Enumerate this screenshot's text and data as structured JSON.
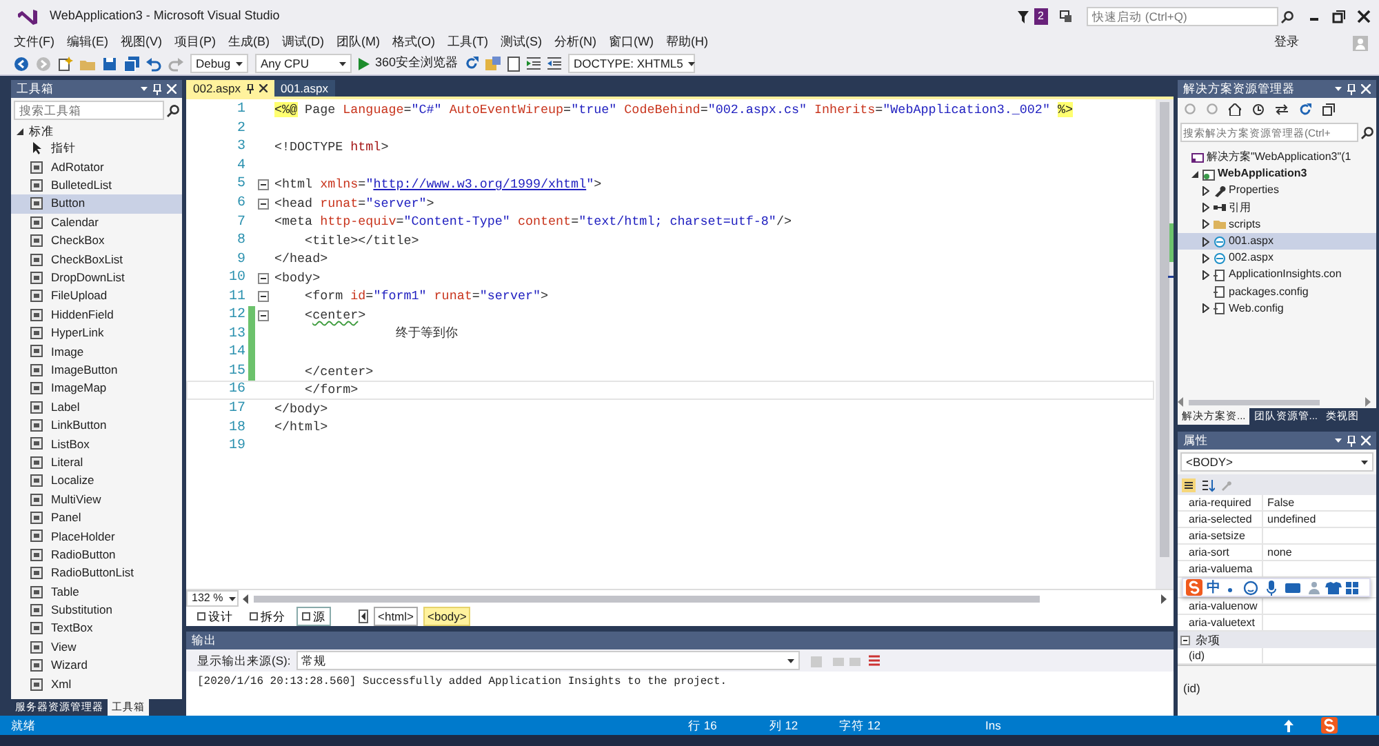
{
  "window": {
    "title": "WebApplication3 - Microsoft Visual Studio",
    "notification_count": "2",
    "quick_launch": {
      "placeholder": "快速启动 (Ctrl+Q)"
    },
    "sign_in": "登录"
  },
  "menu": [
    "文件(F)",
    "编辑(E)",
    "视图(V)",
    "项目(P)",
    "生成(B)",
    "调试(D)",
    "团队(M)",
    "格式(O)",
    "工具(T)",
    "测试(S)",
    "分析(N)",
    "窗口(W)",
    "帮助(H)"
  ],
  "toolbar": {
    "configuration": "Debug",
    "platform": "Any CPU",
    "run_target": "360安全浏览器",
    "doctype": "DOCTYPE: XHTML5"
  },
  "toolbox": {
    "title": "工具箱",
    "search": {
      "placeholder": "搜索工具箱"
    },
    "group": "标准",
    "items": [
      {
        "label": "指针",
        "kind": "pointer",
        "selected": false
      },
      {
        "label": "AdRotator",
        "kind": "control",
        "selected": false
      },
      {
        "label": "BulletedList",
        "kind": "control",
        "selected": false
      },
      {
        "label": "Button",
        "kind": "control",
        "selected": true
      },
      {
        "label": "Calendar",
        "kind": "control",
        "selected": false
      },
      {
        "label": "CheckBox",
        "kind": "control",
        "selected": false
      },
      {
        "label": "CheckBoxList",
        "kind": "control",
        "selected": false
      },
      {
        "label": "DropDownList",
        "kind": "control",
        "selected": false
      },
      {
        "label": "FileUpload",
        "kind": "control",
        "selected": false
      },
      {
        "label": "HiddenField",
        "kind": "control",
        "selected": false
      },
      {
        "label": "HyperLink",
        "kind": "control",
        "selected": false
      },
      {
        "label": "Image",
        "kind": "control",
        "selected": false
      },
      {
        "label": "ImageButton",
        "kind": "control",
        "selected": false
      },
      {
        "label": "ImageMap",
        "kind": "control",
        "selected": false
      },
      {
        "label": "Label",
        "kind": "control",
        "selected": false
      },
      {
        "label": "LinkButton",
        "kind": "control",
        "selected": false
      },
      {
        "label": "ListBox",
        "kind": "control",
        "selected": false
      },
      {
        "label": "Literal",
        "kind": "control",
        "selected": false
      },
      {
        "label": "Localize",
        "kind": "control",
        "selected": false
      },
      {
        "label": "MultiView",
        "kind": "control",
        "selected": false
      },
      {
        "label": "Panel",
        "kind": "control",
        "selected": false
      },
      {
        "label": "PlaceHolder",
        "kind": "control",
        "selected": false
      },
      {
        "label": "RadioButton",
        "kind": "control",
        "selected": false
      },
      {
        "label": "RadioButtonList",
        "kind": "control",
        "selected": false
      },
      {
        "label": "Table",
        "kind": "control",
        "selected": false
      },
      {
        "label": "Substitution",
        "kind": "control",
        "selected": false
      },
      {
        "label": "TextBox",
        "kind": "control",
        "selected": false
      },
      {
        "label": "View",
        "kind": "control",
        "selected": false
      },
      {
        "label": "Wizard",
        "kind": "control",
        "selected": false
      },
      {
        "label": "Xml",
        "kind": "control",
        "selected": false
      }
    ],
    "tabs": [
      {
        "label": "服务器资源管理器",
        "selected": false
      },
      {
        "label": "工具箱",
        "selected": true
      }
    ]
  },
  "editor": {
    "tabs": [
      {
        "label": "002.aspx",
        "selected": true,
        "pinned": true
      },
      {
        "label": "001.aspx",
        "selected": false,
        "pinned": false
      }
    ],
    "lines": [
      {
        "number": "1",
        "fold": false,
        "changed": false,
        "current": false,
        "tokens": [
          {
            "kind": "directive",
            "text": "<%@"
          },
          {
            "kind": "plain",
            "text": " Page "
          },
          {
            "kind": "attr",
            "text": "Language"
          },
          {
            "kind": "plain",
            "text": "="
          },
          {
            "kind": "value",
            "text": "\"C#\" "
          },
          {
            "kind": "attr",
            "text": "AutoEventWireup"
          },
          {
            "kind": "plain",
            "text": "="
          },
          {
            "kind": "value",
            "text": "\"true\" "
          },
          {
            "kind": "attr",
            "text": "CodeBehind"
          },
          {
            "kind": "plain",
            "text": "="
          },
          {
            "kind": "value",
            "text": "\"002.aspx.cs\" "
          },
          {
            "kind": "attr",
            "text": "Inherits"
          },
          {
            "kind": "plain",
            "text": "="
          },
          {
            "kind": "value",
            "text": "\"WebApplication3._002\" "
          },
          {
            "kind": "directive",
            "text": "%>"
          }
        ]
      },
      {
        "number": "2",
        "fold": false,
        "changed": false,
        "current": false
      },
      {
        "number": "3",
        "fold": false,
        "changed": false,
        "current": false,
        "tokens": [
          {
            "kind": "plain",
            "text": "<!DOCTYPE "
          },
          {
            "kind": "element",
            "text": "html"
          },
          {
            "kind": "plain",
            "text": ">"
          }
        ]
      },
      {
        "number": "4",
        "fold": false,
        "changed": false,
        "current": false
      },
      {
        "number": "5",
        "fold": true,
        "changed": false,
        "current": false,
        "tokens": [
          {
            "kind": "plain",
            "text": "<html "
          },
          {
            "kind": "attr",
            "text": "xmlns"
          },
          {
            "kind": "plain",
            "text": "="
          },
          {
            "kind": "value",
            "text": "\""
          },
          {
            "kind": "link",
            "text": "http://www.w3.org/1999/xhtml"
          },
          {
            "kind": "value",
            "text": "\""
          },
          {
            "kind": "plain",
            "text": ">"
          }
        ]
      },
      {
        "number": "6",
        "fold": true,
        "changed": false,
        "current": false,
        "tokens": [
          {
            "kind": "plain",
            "text": "<head "
          },
          {
            "kind": "attr",
            "text": "runat"
          },
          {
            "kind": "plain",
            "text": "="
          },
          {
            "kind": "value",
            "text": "\"server\""
          },
          {
            "kind": "plain",
            "text": ">"
          }
        ]
      },
      {
        "number": "7",
        "fold": false,
        "changed": false,
        "current": false,
        "tokens": [
          {
            "kind": "plain",
            "text": "<meta "
          },
          {
            "kind": "attr",
            "text": "http-equiv"
          },
          {
            "kind": "plain",
            "text": "="
          },
          {
            "kind": "value",
            "text": "\"Content-Type\" "
          },
          {
            "kind": "attr",
            "text": "content"
          },
          {
            "kind": "plain",
            "text": "="
          },
          {
            "kind": "value",
            "text": "\"text/html; charset=utf-8\""
          },
          {
            "kind": "plain",
            "text": "/>"
          }
        ]
      },
      {
        "number": "8",
        "fold": false,
        "changed": false,
        "current": false,
        "tokens": [
          {
            "kind": "plain",
            "text": "    <title></title>"
          }
        ]
      },
      {
        "number": "9",
        "fold": false,
        "changed": false,
        "current": false,
        "tokens": [
          {
            "kind": "plain",
            "text": "</head>"
          }
        ]
      },
      {
        "number": "10",
        "fold": true,
        "changed": false,
        "current": false,
        "tokens": [
          {
            "kind": "plain",
            "text": "<body>"
          }
        ]
      },
      {
        "number": "11",
        "fold": true,
        "changed": false,
        "current": false,
        "tokens": [
          {
            "kind": "plain",
            "text": "    <form "
          },
          {
            "kind": "attr",
            "text": "id"
          },
          {
            "kind": "plain",
            "text": "="
          },
          {
            "kind": "value",
            "text": "\"form1\" "
          },
          {
            "kind": "attr",
            "text": "runat"
          },
          {
            "kind": "plain",
            "text": "="
          },
          {
            "kind": "value",
            "text": "\"server\""
          },
          {
            "kind": "plain",
            "text": ">"
          }
        ]
      },
      {
        "number": "12",
        "fold": true,
        "changed": true,
        "current": false,
        "tokens": [
          {
            "kind": "plain",
            "text": "    <"
          },
          {
            "kind": "warning",
            "text": "center"
          },
          {
            "kind": "plain",
            "text": ">"
          }
        ]
      },
      {
        "number": "13",
        "fold": false,
        "changed": true,
        "current": false,
        "tokens": [
          {
            "kind": "plain",
            "text": "                终于等到你"
          }
        ]
      },
      {
        "number": "14",
        "fold": false,
        "changed": true,
        "current": false
      },
      {
        "number": "15",
        "fold": false,
        "changed": true,
        "current": false,
        "tokens": [
          {
            "kind": "plain",
            "text": "    </center>"
          }
        ]
      },
      {
        "number": "16",
        "fold": false,
        "changed": false,
        "current": true,
        "tokens": [
          {
            "kind": "plain",
            "text": "    </form>"
          }
        ]
      },
      {
        "number": "17",
        "fold": false,
        "changed": false,
        "current": false,
        "tokens": [
          {
            "kind": "plain",
            "text": "</body>"
          }
        ]
      },
      {
        "number": "18",
        "fold": false,
        "changed": false,
        "current": false,
        "tokens": [
          {
            "kind": "plain",
            "text": "</html>"
          }
        ]
      },
      {
        "number": "19",
        "fold": false,
        "changed": false,
        "current": false
      }
    ],
    "zoom": "132 %",
    "view_tabs": [
      {
        "label": "设计",
        "selected": false
      },
      {
        "label": "拆分",
        "selected": false
      },
      {
        "label": "源",
        "selected": true
      }
    ],
    "breadcrumb": [
      {
        "label": "<html>",
        "selected": false
      },
      {
        "label": "<body>",
        "selected": true
      }
    ]
  },
  "output": {
    "title": "输出",
    "source_label": "显示输出来源(S):",
    "source": "常规",
    "text": "[2020/1/16 20:13:28.560] Successfully added Application Insights to the project."
  },
  "solution_explorer": {
    "title": "解决方案资源管理器",
    "search": {
      "placeholder": "搜索解决方案资源管理器(Ctrl+"
    },
    "tree": [
      {
        "label": "解决方案\"WebApplication3\"(1",
        "kind": "solution",
        "expandable": false,
        "selected": false,
        "children": [
          {
            "label": "WebApplication3",
            "kind": "project",
            "expandable": true,
            "expanded": true,
            "selected": false,
            "children": [
              {
                "label": "Properties",
                "kind": "properties",
                "expandable": true,
                "expanded": false,
                "selected": false
              },
              {
                "label": "引用",
                "kind": "references",
                "expandable": true,
                "expanded": false,
                "selected": false
              },
              {
                "label": "scripts",
                "kind": "folder",
                "expandable": true,
                "expanded": false,
                "selected": false
              },
              {
                "label": "001.aspx",
                "kind": "page",
                "expandable": true,
                "expanded": false,
                "selected": true
              },
              {
                "label": "002.aspx",
                "kind": "page",
                "expandable": true,
                "expanded": false,
                "selected": false
              },
              {
                "label": "ApplicationInsights.con",
                "kind": "config",
                "expandable": true,
                "expanded": false,
                "selected": false
              },
              {
                "label": "packages.config",
                "kind": "config",
                "expandable": false,
                "selected": false
              },
              {
                "label": "Web.config",
                "kind": "config",
                "expandable": true,
                "expanded": false,
                "selected": false
              }
            ]
          }
        ]
      }
    ],
    "tabs": [
      {
        "label": "解决方案资...",
        "selected": true
      },
      {
        "label": "团队资源管...",
        "selected": false
      },
      {
        "label": "类视图",
        "selected": false
      }
    ]
  },
  "properties": {
    "title": "属性",
    "object": "<BODY>",
    "rows": [
      {
        "name": "aria-required",
        "value": "False"
      },
      {
        "name": "aria-selected",
        "value": "undefined"
      },
      {
        "name": "aria-setsize"
      },
      {
        "name": "aria-sort",
        "value": "none"
      },
      {
        "name": "aria-valuema"
      },
      {
        "name": "aria-valuenow"
      },
      {
        "name": "aria-valuetext"
      }
    ],
    "category": "杂项",
    "category_rows": [
      {
        "name": "(id)"
      }
    ],
    "description": "(id)"
  },
  "ime_toolbar": {
    "mode": "中"
  },
  "status_bar": {
    "message": "就绪",
    "line": "行 16",
    "column": "列 12",
    "char": "字符 12",
    "mode": "Ins"
  }
}
